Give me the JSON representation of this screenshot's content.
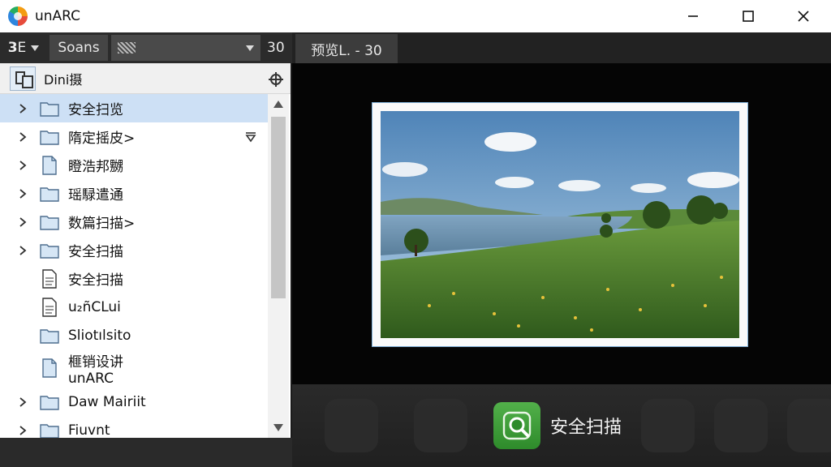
{
  "window": {
    "title": "unARC",
    "controls": [
      "minimize",
      "maximize",
      "close"
    ]
  },
  "left_toolbar": {
    "view_mode_label": "𝟯E",
    "sort_label": "Soans",
    "filter_value": "",
    "count": "30"
  },
  "right_toolbar": {
    "preview_tab_label": "预览L. - 30"
  },
  "sidebar": {
    "title": "Dini摄",
    "items": [
      {
        "label": "安全扫览",
        "type": "folder",
        "expandable": true,
        "selected": true
      },
      {
        "label": "隋定摇皮>",
        "type": "folder",
        "expandable": true,
        "has_filter": true
      },
      {
        "label": "瞪浩邦嬲",
        "type": "file",
        "expandable": true
      },
      {
        "label": "瑶騄遣通",
        "type": "folder",
        "expandable": true
      },
      {
        "label": "数篇扫描>",
        "type": "folder",
        "expandable": true
      },
      {
        "label": "安全扫描",
        "type": "folder",
        "expandable": true
      },
      {
        "label": "安全扫描",
        "type": "document",
        "expandable": false
      },
      {
        "label": "u₂ñCLui",
        "type": "document",
        "expandable": false
      },
      {
        "label": "Sliotılsito",
        "type": "folder",
        "expandable": false
      },
      {
        "label": "榧销设讲",
        "sublabel": "unARC",
        "type": "file",
        "expandable": false
      },
      {
        "label": "Daw Mairiit",
        "type": "folder",
        "expandable": true
      },
      {
        "label": "Fiuvnt",
        "type": "folder",
        "expandable": true
      }
    ]
  },
  "preview": {
    "image_subject": "landscape-photo-lake-meadow"
  },
  "action_bar": {
    "scan_label": "安全扫描"
  },
  "colors": {
    "selection": "#cde0f5",
    "accent_green": "#3a9d35",
    "frame_border": "#7fb0d8"
  }
}
